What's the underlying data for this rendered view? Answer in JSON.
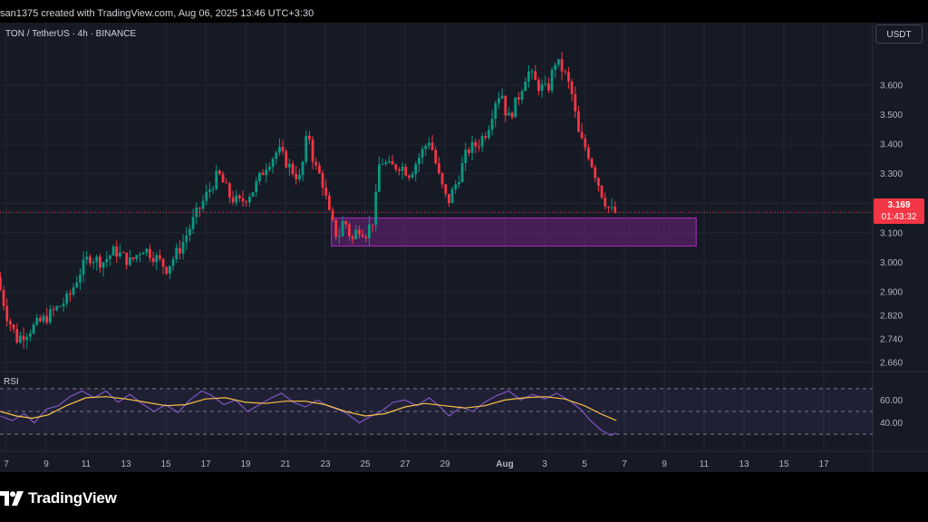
{
  "header": {
    "text": "san1375 created with TradingView.com, Aug 06, 2025 13:46 UTC+3:30"
  },
  "symbol": {
    "label": "TON / TetherUS · 4h · BINANCE"
  },
  "currency_button": "USDT",
  "price_badge": {
    "price": "3.169",
    "countdown": "01:43:32"
  },
  "rsi": {
    "label": "RSI",
    "ticks": [
      {
        "value": 60,
        "label": "60.00"
      },
      {
        "value": 40,
        "label": "40.00"
      }
    ]
  },
  "footer": {
    "brand": "TradingView"
  },
  "chart_data": {
    "type": "candlestick",
    "symbol": "TON / TetherUS",
    "interval": "4h",
    "exchange": "BINANCE",
    "last_price": 3.169,
    "ylim": [
      2.63,
      3.75
    ],
    "y_ticks": [
      {
        "value": 3.6,
        "label": "3.600"
      },
      {
        "value": 3.5,
        "label": "3.500"
      },
      {
        "value": 3.4,
        "label": "3.400"
      },
      {
        "value": 3.3,
        "label": "3.300"
      },
      {
        "value": 3.2,
        "label": "3.200"
      },
      {
        "value": 3.1,
        "label": "3.100"
      },
      {
        "value": 3.0,
        "label": "3.000"
      },
      {
        "value": 2.9,
        "label": "2.900"
      },
      {
        "value": 2.82,
        "label": "2.820"
      },
      {
        "value": 2.74,
        "label": "2.740"
      },
      {
        "value": 2.66,
        "label": "2.660"
      }
    ],
    "x_ticks": [
      {
        "day": 7,
        "label": "7"
      },
      {
        "day": 9,
        "label": "9"
      },
      {
        "day": 11,
        "label": "11"
      },
      {
        "day": 13,
        "label": "13"
      },
      {
        "day": 15,
        "label": "15"
      },
      {
        "day": 17,
        "label": "17"
      },
      {
        "day": 19,
        "label": "19"
      },
      {
        "day": 21,
        "label": "21"
      },
      {
        "day": 23,
        "label": "23"
      },
      {
        "day": 25,
        "label": "25"
      },
      {
        "day": 27,
        "label": "27"
      },
      {
        "day": 29,
        "label": "29"
      },
      {
        "day": 32,
        "label": "Aug"
      },
      {
        "day": 34,
        "label": "3"
      },
      {
        "day": 36,
        "label": "5"
      },
      {
        "day": 38,
        "label": "7"
      },
      {
        "day": 40,
        "label": "9"
      },
      {
        "day": 42,
        "label": "11"
      },
      {
        "day": 44,
        "label": "13"
      },
      {
        "day": 46,
        "label": "15"
      },
      {
        "day": 48,
        "label": "17"
      }
    ],
    "price_path": [
      [
        6.7,
        2.95
      ],
      [
        7.2,
        2.82
      ],
      [
        7.7,
        2.74
      ],
      [
        8.5,
        2.78
      ],
      [
        9.3,
        2.82
      ],
      [
        10.3,
        2.88
      ],
      [
        10.8,
        2.96
      ],
      [
        11.3,
        3.02
      ],
      [
        12.0,
        3.0
      ],
      [
        12.6,
        3.04
      ],
      [
        13.4,
        3.0
      ],
      [
        14.0,
        3.05
      ],
      [
        14.6,
        3.02
      ],
      [
        15.2,
        2.98
      ],
      [
        15.9,
        3.05
      ],
      [
        16.6,
        3.15
      ],
      [
        17.3,
        3.24
      ],
      [
        17.8,
        3.3
      ],
      [
        18.4,
        3.22
      ],
      [
        18.9,
        3.2
      ],
      [
        19.6,
        3.25
      ],
      [
        20.2,
        3.33
      ],
      [
        20.8,
        3.38
      ],
      [
        21.4,
        3.32
      ],
      [
        21.9,
        3.28
      ],
      [
        22.3,
        3.45
      ],
      [
        22.6,
        3.33
      ],
      [
        23.0,
        3.28
      ],
      [
        23.4,
        3.15
      ],
      [
        23.8,
        3.08
      ],
      [
        24.1,
        3.15
      ],
      [
        24.5,
        3.07
      ],
      [
        24.8,
        3.12
      ],
      [
        25.2,
        3.1
      ],
      [
        25.6,
        3.15
      ],
      [
        25.9,
        3.35
      ],
      [
        26.4,
        3.32
      ],
      [
        26.9,
        3.33
      ],
      [
        27.4,
        3.3
      ],
      [
        27.9,
        3.36
      ],
      [
        28.4,
        3.42
      ],
      [
        28.9,
        3.28
      ],
      [
        29.3,
        3.2
      ],
      [
        29.8,
        3.28
      ],
      [
        30.3,
        3.38
      ],
      [
        30.8,
        3.4
      ],
      [
        31.3,
        3.45
      ],
      [
        31.7,
        3.55
      ],
      [
        32.0,
        3.58
      ],
      [
        32.3,
        3.48
      ],
      [
        32.8,
        3.55
      ],
      [
        33.3,
        3.65
      ],
      [
        33.8,
        3.6
      ],
      [
        34.3,
        3.58
      ],
      [
        34.7,
        3.68
      ],
      [
        35.1,
        3.65
      ],
      [
        35.5,
        3.58
      ],
      [
        35.9,
        3.42
      ],
      [
        36.3,
        3.38
      ],
      [
        36.7,
        3.3
      ],
      [
        37.1,
        3.22
      ],
      [
        37.4,
        3.18
      ],
      [
        37.6,
        3.169
      ]
    ],
    "zones": [
      {
        "from": 23.3,
        "to": 41.6,
        "low": 3.055,
        "high": 3.15,
        "color": "#9c27b0"
      }
    ],
    "rsi": {
      "ylim": [
        15,
        85
      ],
      "levels": [
        70,
        50,
        30
      ],
      "rsi_series": [
        [
          6.7,
          46
        ],
        [
          7.3,
          42
        ],
        [
          7.9,
          48
        ],
        [
          8.4,
          40
        ],
        [
          9.0,
          52
        ],
        [
          9.6,
          55
        ],
        [
          10.2,
          63
        ],
        [
          10.8,
          68
        ],
        [
          11.4,
          62
        ],
        [
          12.0,
          68
        ],
        [
          12.6,
          58
        ],
        [
          13.2,
          65
        ],
        [
          13.8,
          57
        ],
        [
          14.4,
          50
        ],
        [
          15.0,
          56
        ],
        [
          15.6,
          49
        ],
        [
          16.2,
          60
        ],
        [
          16.8,
          68
        ],
        [
          17.3,
          64
        ],
        [
          17.9,
          56
        ],
        [
          18.5,
          60
        ],
        [
          19.1,
          50
        ],
        [
          19.7,
          56
        ],
        [
          20.3,
          62
        ],
        [
          20.8,
          66
        ],
        [
          21.4,
          58
        ],
        [
          22.0,
          54
        ],
        [
          22.6,
          60
        ],
        [
          23.1,
          55
        ],
        [
          23.6,
          52
        ],
        [
          24.1,
          48
        ],
        [
          24.7,
          40
        ],
        [
          25.2,
          45
        ],
        [
          25.8,
          50
        ],
        [
          26.4,
          58
        ],
        [
          27.0,
          60
        ],
        [
          27.6,
          55
        ],
        [
          28.2,
          62
        ],
        [
          28.7,
          55
        ],
        [
          29.2,
          46
        ],
        [
          29.8,
          54
        ],
        [
          30.4,
          50
        ],
        [
          31.0,
          58
        ],
        [
          31.6,
          64
        ],
        [
          32.2,
          68
        ],
        [
          32.8,
          60
        ],
        [
          33.4,
          65
        ],
        [
          34.0,
          61
        ],
        [
          34.6,
          66
        ],
        [
          35.2,
          60
        ],
        [
          35.8,
          52
        ],
        [
          36.3,
          42
        ],
        [
          36.8,
          34
        ],
        [
          37.3,
          29
        ],
        [
          37.6,
          31
        ]
      ],
      "ma_series": [
        [
          6.7,
          50
        ],
        [
          7.5,
          46
        ],
        [
          8.3,
          44
        ],
        [
          9.1,
          47
        ],
        [
          10.0,
          55
        ],
        [
          11.0,
          62
        ],
        [
          12.0,
          63
        ],
        [
          13.0,
          61
        ],
        [
          14.0,
          58
        ],
        [
          15.0,
          55
        ],
        [
          16.0,
          56
        ],
        [
          17.0,
          61
        ],
        [
          18.0,
          62
        ],
        [
          19.0,
          58
        ],
        [
          20.0,
          57
        ],
        [
          21.0,
          59
        ],
        [
          22.0,
          59
        ],
        [
          23.0,
          56
        ],
        [
          24.0,
          50
        ],
        [
          25.0,
          46
        ],
        [
          26.0,
          48
        ],
        [
          27.0,
          54
        ],
        [
          28.0,
          57
        ],
        [
          29.0,
          55
        ],
        [
          30.0,
          53
        ],
        [
          31.0,
          55
        ],
        [
          32.0,
          60
        ],
        [
          33.0,
          62
        ],
        [
          34.0,
          63
        ],
        [
          35.0,
          61
        ],
        [
          36.0,
          55
        ],
        [
          36.8,
          48
        ],
        [
          37.6,
          42
        ]
      ]
    }
  }
}
